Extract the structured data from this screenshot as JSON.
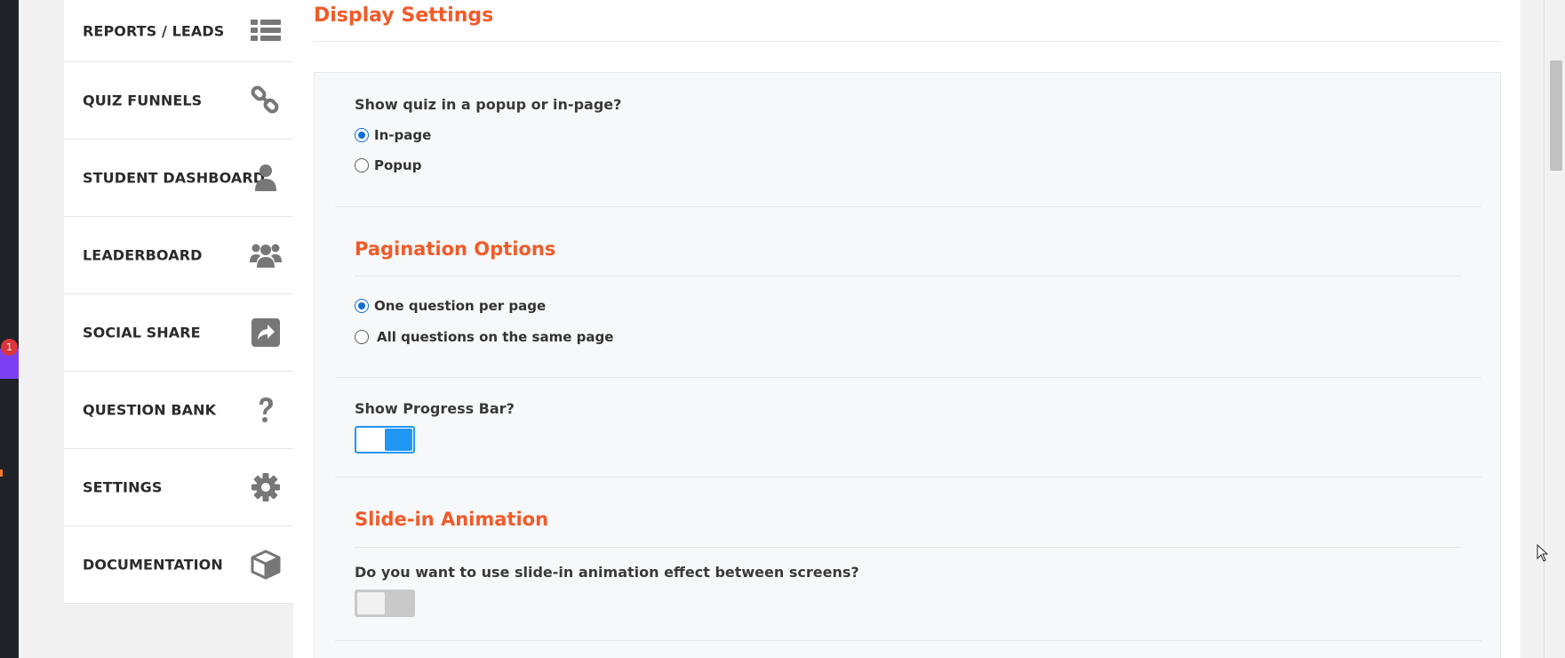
{
  "admin_bar": {
    "notification_count": "1",
    "accent": "#7b3ff2",
    "badge_color": "#d9363a"
  },
  "sidebar": {
    "items": [
      {
        "label": "REPORTS / LEADS",
        "icon": "list-icon"
      },
      {
        "label": "QUIZ FUNNELS",
        "icon": "link-icon"
      },
      {
        "label": "STUDENT DASHBOARD",
        "icon": "user-icon"
      },
      {
        "label": "LEADERBOARD",
        "icon": "users-icon"
      },
      {
        "label": "SOCIAL SHARE",
        "icon": "share-icon"
      },
      {
        "label": "QUESTION BANK",
        "icon": "question-icon"
      },
      {
        "label": "SETTINGS",
        "icon": "gear-icon"
      },
      {
        "label": "DOCUMENTATION",
        "icon": "cube-icon"
      }
    ]
  },
  "main": {
    "title": "Display Settings",
    "display_mode": {
      "question": "Show quiz in a popup or in-page?",
      "options": [
        "In-page",
        "Popup"
      ],
      "selected": "In-page"
    },
    "pagination": {
      "title": "Pagination Options",
      "options": [
        "One question per page",
        "All questions on the same page"
      ],
      "selected": "One question per page"
    },
    "progress_bar": {
      "question": "Show Progress Bar?",
      "enabled": true
    },
    "slide_in": {
      "title": "Slide-in Animation",
      "question": "Do you want to use slide-in animation effect between screens?",
      "enabled": false
    }
  },
  "colors": {
    "heading": "#f15a29",
    "toggle_on": "#2196f3",
    "radio_checked": "#0f6ed6"
  }
}
